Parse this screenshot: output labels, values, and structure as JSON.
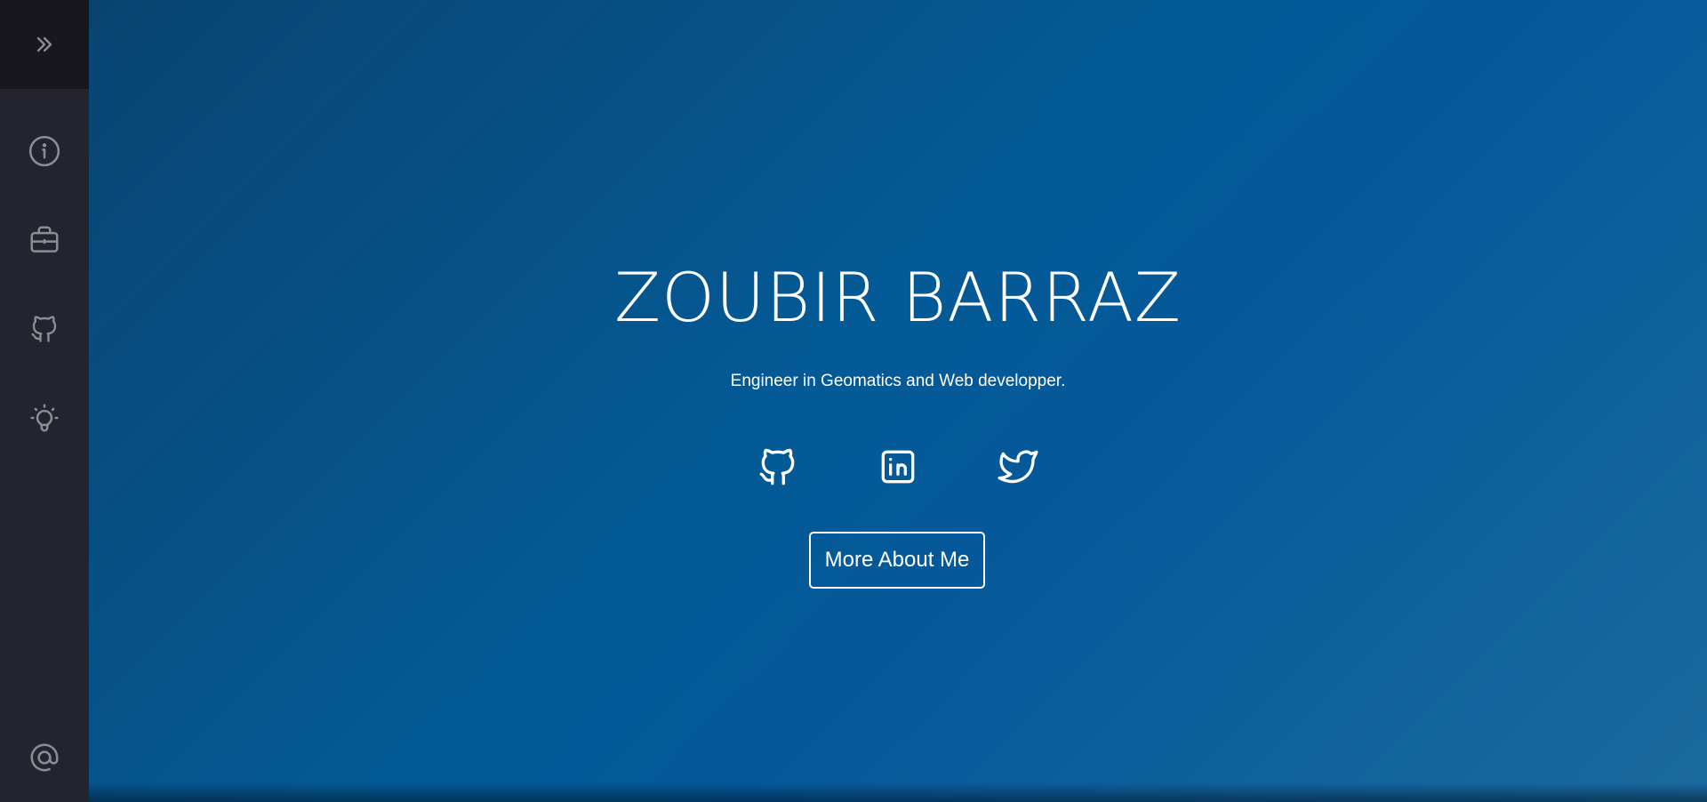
{
  "sidebar": {
    "toggle_icon": "double-chevron-right-icon",
    "items": [
      {
        "icon": "info-icon",
        "name": "about"
      },
      {
        "icon": "briefcase-icon",
        "name": "experience"
      },
      {
        "icon": "github-icon",
        "name": "github"
      },
      {
        "icon": "lightbulb-icon",
        "name": "ideas"
      }
    ],
    "contact_icon": "at-icon",
    "icon_color": "#8c8c94",
    "background": "#24242e"
  },
  "hero": {
    "title": "ZOUBIR BARRAZ",
    "subtitle": "Engineer in Geomatics and Web developper.",
    "socials": [
      {
        "icon": "github-icon",
        "name": "github"
      },
      {
        "icon": "linkedin-icon",
        "name": "linkedin"
      },
      {
        "icon": "twitter-icon",
        "name": "twitter"
      }
    ],
    "cta_label": "More About Me",
    "text_color": "#ffffff"
  }
}
